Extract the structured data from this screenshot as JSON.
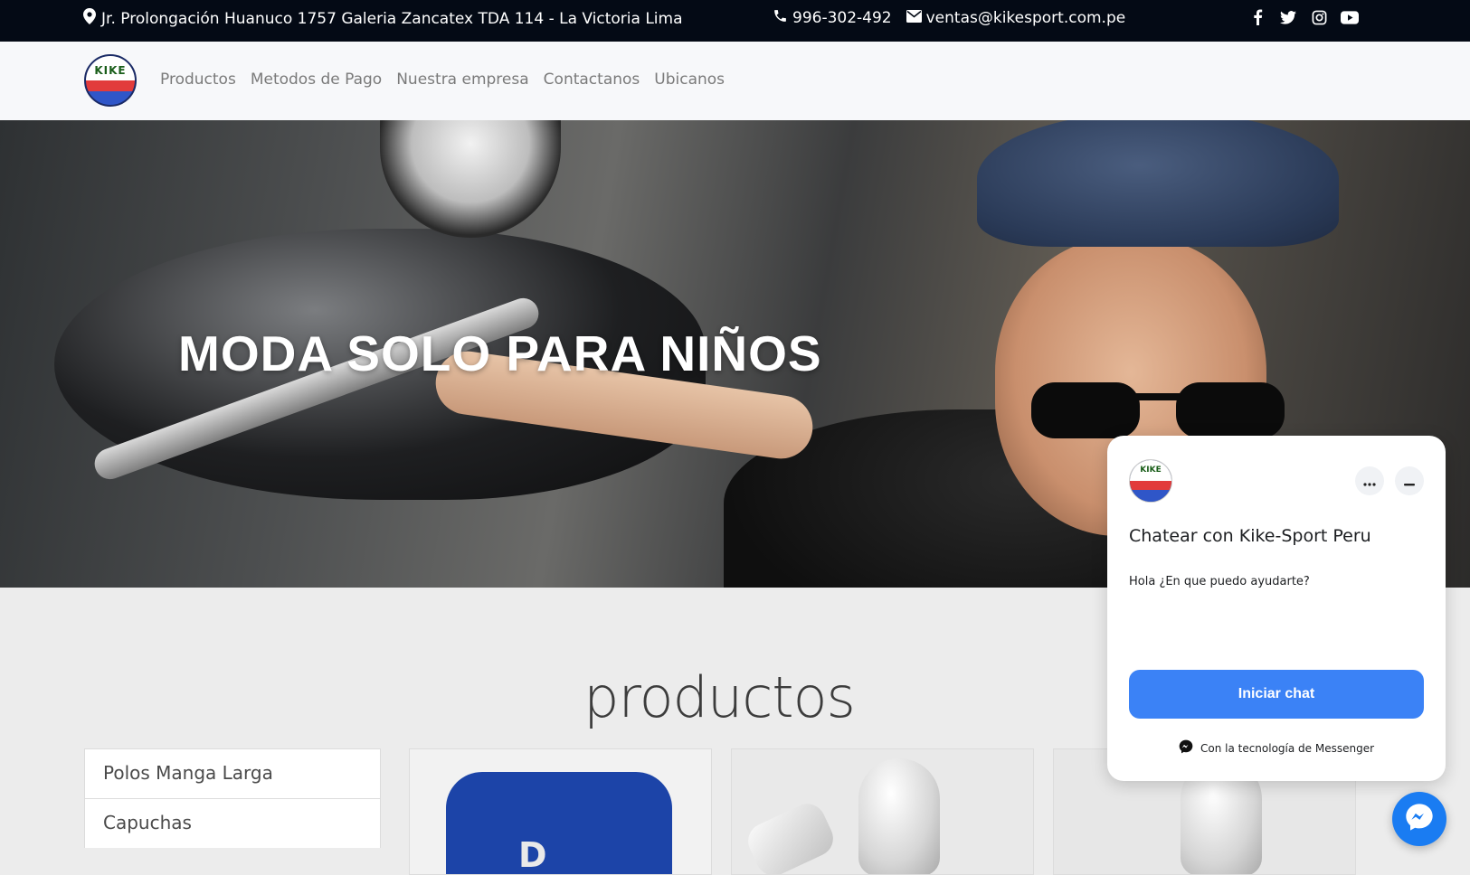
{
  "topbar": {
    "address": "Jr. Prolongación Huanuco 1757 Galeria Zancatex TDA 114 - La Victoria Lima",
    "phone": "996-302-492",
    "email": "ventas@kikesport.com.pe",
    "social_icons": [
      "facebook-icon",
      "twitter-icon",
      "instagram-icon",
      "youtube-icon"
    ]
  },
  "nav": {
    "logo_text": "KIKE",
    "items": [
      "Productos",
      "Metodos de Pago",
      "Nuestra empresa",
      "Contactanos",
      "Ubicanos"
    ]
  },
  "hero": {
    "title": "MODA SOLO PARA NIÑOS"
  },
  "products": {
    "title": "productos",
    "categories": [
      "Polos Manga Larga",
      "Capuchas"
    ]
  },
  "chat": {
    "title": "Chatear con Kike-Sport Peru",
    "greeting": "Hola ¿En que puedo ayudarte?",
    "start_label": "Iniciar chat",
    "powered_by": "Con la tecnología de Messenger"
  },
  "colors": {
    "topbar_bg": "#040a15",
    "chat_button": "#3b82f6",
    "messenger_fab": "#1a7cf2"
  }
}
